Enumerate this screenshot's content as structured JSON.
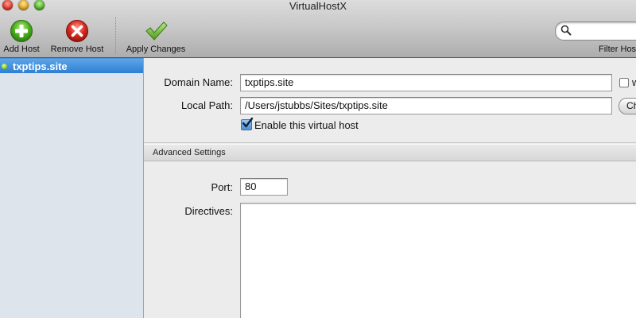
{
  "window": {
    "title": "VirtualHostX"
  },
  "toolbar": {
    "add_label": "Add Host",
    "remove_label": "Remove Host",
    "apply_label": "Apply Changes",
    "filter_label": "Filter Hos",
    "search_value": ""
  },
  "sidebar": {
    "items": [
      {
        "label": "txptips.site",
        "status": "active",
        "selected": true
      }
    ]
  },
  "form": {
    "domain_label": "Domain Name:",
    "domain_value": "txptips.site",
    "path_label": "Local Path:",
    "path_value": "/Users/jstubbs/Sites/txptips.site",
    "choose_label": "Ch",
    "extra_checkbox_label": "w",
    "enable_label": "Enable this virtual host",
    "enable_checked": true,
    "advanced_header": "Advanced Settings",
    "port_label": "Port:",
    "port_value": "80",
    "directives_label": "Directives:",
    "directives_value": ""
  },
  "colors": {
    "selection": "#2f7fd3",
    "sidebar_bg": "#dde4ec",
    "add_icon": "#4caf1f",
    "remove_icon": "#d92b1e",
    "apply_icon": "#6cbf2a"
  },
  "icons": {
    "add": "plus-circle-icon",
    "remove": "x-circle-icon",
    "apply": "checkmark-icon",
    "search": "magnifier-icon"
  }
}
